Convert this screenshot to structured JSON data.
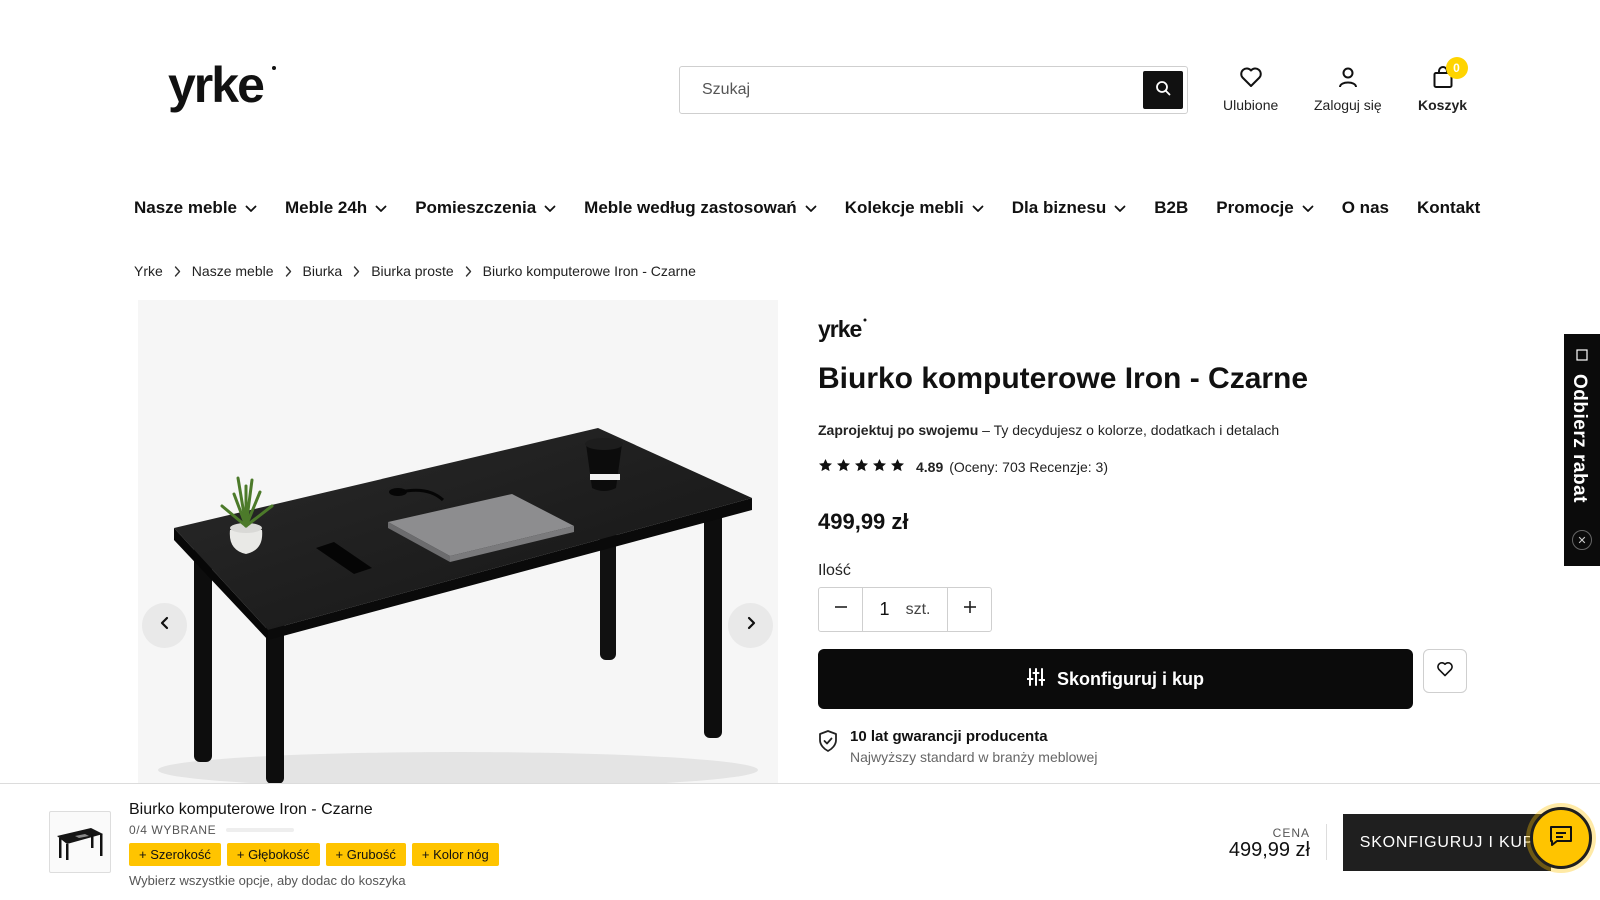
{
  "header": {
    "logo_text": "yrke",
    "search": {
      "placeholder": "Szukaj"
    },
    "favorites_label": "Ulubione",
    "login_label": "Zaloguj się",
    "cart_label": "Koszyk",
    "cart_count": "0"
  },
  "nav": {
    "items": [
      {
        "label": "Nasze meble",
        "has_dropdown": true
      },
      {
        "label": "Meble 24h",
        "has_dropdown": true
      },
      {
        "label": "Pomieszczenia",
        "has_dropdown": true
      },
      {
        "label": "Meble według zastosowań",
        "has_dropdown": true
      },
      {
        "label": "Kolekcje mebli",
        "has_dropdown": true
      },
      {
        "label": "Dla biznesu",
        "has_dropdown": true
      },
      {
        "label": "B2B",
        "has_dropdown": false
      },
      {
        "label": "Promocje",
        "has_dropdown": true
      },
      {
        "label": "O nas",
        "has_dropdown": false
      },
      {
        "label": "Kontakt",
        "has_dropdown": false
      }
    ]
  },
  "breadcrumb": [
    "Yrke",
    "Nasze meble",
    "Biurka",
    "Biurka proste",
    "Biurko komputerowe Iron - Czarne"
  ],
  "product": {
    "brand": "yrke",
    "title": "Biurko komputerowe Iron - Czarne",
    "subtitle_bold": "Zaprojektuj po swojemu",
    "subtitle_rest": " – Ty decydujesz o kolorze, dodatkach i detalach",
    "rating": 4.89,
    "rating_text": "4.89",
    "rating_meta": "(Oceny: 703 Recenzje: 3)",
    "price": "499,99 zł",
    "quantity_label": "Ilość",
    "quantity_value": "1",
    "quantity_unit": "szt.",
    "cta_label": "Skonfiguruj i kup",
    "warranty_title": "10 lat gwarancji producenta",
    "warranty_sub": "Najwyższy standard w branży meblowej"
  },
  "side_tab": {
    "label": "Odbierz rabat",
    "close_symbol": "✕"
  },
  "sticky_bar": {
    "product_name": "Biurko komputerowe Iron - Czarne",
    "progress_text": "0/4 WYBRANE",
    "chips": [
      "+ Szerokość",
      "+ Głębokość",
      "+ Grubość",
      "+ Kolor nóg"
    ],
    "hint": "Wybierz wszystkie opcje, aby dodac do koszyka",
    "price_label": "CENA",
    "price": "499,99 zł",
    "cta_label": "SKONFIGURUJ I KUP"
  },
  "colors": {
    "accent_yellow": "#ffc400",
    "badge_yellow": "#ffd400",
    "primary_black": "#0b0b0b"
  }
}
